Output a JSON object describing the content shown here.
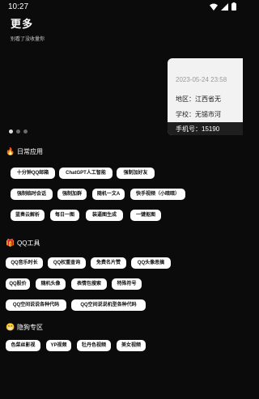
{
  "status_bar": {
    "time": "10:27"
  },
  "header": {
    "title": "更多",
    "subtitle": "别看了没收量你"
  },
  "banner": {
    "timestamp": "2023-05-24 23:58",
    "lines": [
      "地区：江西省无",
      "学校：无锡市河",
      "手机号：15190"
    ]
  },
  "carousel": {
    "dot_count": 3,
    "active_index": 0
  },
  "sections": {
    "daily": {
      "icon": "fire-icon",
      "title": "日常应用",
      "items": [
        "十分钟QQ邮箱",
        "ChatGPT人工智能",
        "强制加好友",
        "强制临时会话",
        "强制加群",
        "随机一文A",
        "快手视频（小暗暗）",
        "蓝奏云解析",
        "每日一图",
        "装逼图生成",
        "一键抠图"
      ]
    },
    "qq": {
      "icon": "gift-icon",
      "title": "QQ工具",
      "items": [
        "QQ音乐时长",
        "QQ权重查询",
        "免费名片赞",
        "QQ头像恶搞",
        "QQ股价",
        "随机头像",
        "表情包搜索",
        "特殊符号",
        "QQ空间说说各种代码",
        "QQ空间说说机型各种代码"
      ]
    },
    "special": {
      "icon": "grin-icon",
      "title": "隐狗专区",
      "items": [
        "色菜丝影视",
        "YP视频",
        "牡丹色视频",
        "美女视频"
      ]
    }
  },
  "colors": {
    "background": "#0b0b0b",
    "chip_bg": "#ffffff",
    "chip_text": "#111111"
  }
}
